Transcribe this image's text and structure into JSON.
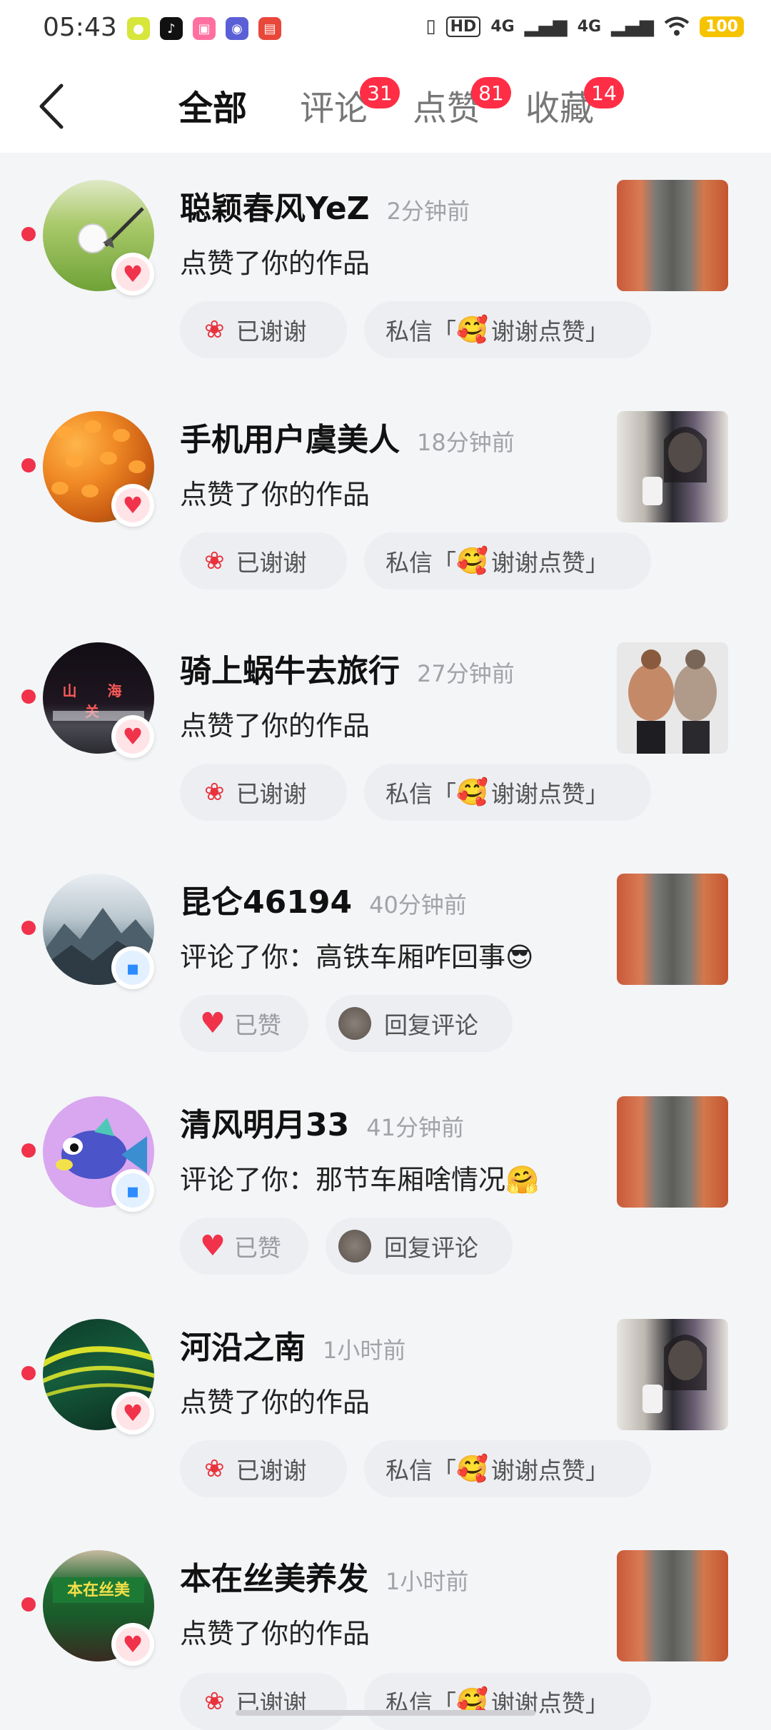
{
  "status_bar": {
    "time": "05:43",
    "network_1": "4G",
    "network_2": "4G",
    "hd_label": "HD",
    "battery": "100"
  },
  "header": {
    "tabs": [
      {
        "label": "全部",
        "active": true
      },
      {
        "label": "评论",
        "badge": "31"
      },
      {
        "label": "点赞",
        "badge": "81"
      },
      {
        "label": "收藏",
        "badge": "14"
      }
    ]
  },
  "notifications": [
    {
      "name": "聪颖春风YeZ",
      "time": "2分钟前",
      "action": "点赞了你的作品",
      "type": "like",
      "buttons": {
        "thanked": "已谢谢",
        "dm_prefix": "私信「",
        "dm_text": "谢谢点赞",
        "dm_suffix": "」"
      }
    },
    {
      "name": "手机用户虞美人",
      "time": "18分钟前",
      "action": "点赞了你的作品",
      "type": "like",
      "buttons": {
        "thanked": "已谢谢",
        "dm_prefix": "私信「",
        "dm_text": "谢谢点赞",
        "dm_suffix": "」"
      }
    },
    {
      "name": "骑上蜗牛去旅行",
      "time": "27分钟前",
      "action": "点赞了你的作品",
      "type": "like",
      "buttons": {
        "thanked": "已谢谢",
        "dm_prefix": "私信「",
        "dm_text": "谢谢点赞",
        "dm_suffix": "」"
      }
    },
    {
      "name": "昆仑46194",
      "time": "40分钟前",
      "action": "评论了你：高铁车厢咋回事😎",
      "type": "comment",
      "buttons": {
        "liked": "已赞",
        "reply": "回复评论"
      }
    },
    {
      "name": "清风明月33",
      "time": "41分钟前",
      "action": "评论了你：那节车厢啥情况🤗",
      "type": "comment",
      "buttons": {
        "liked": "已赞",
        "reply": "回复评论"
      }
    },
    {
      "name": "河沿之南",
      "time": "1小时前",
      "action": "点赞了你的作品",
      "type": "like",
      "buttons": {
        "thanked": "已谢谢",
        "dm_prefix": "私信「",
        "dm_text": "谢谢点赞",
        "dm_suffix": "」"
      }
    },
    {
      "name": "本在丝美养发",
      "time": "1小时前",
      "action": "点赞了你的作品",
      "type": "like",
      "buttons": {
        "thanked": "已谢谢",
        "dm_prefix": "私信「",
        "dm_text": "谢谢点赞",
        "dm_suffix": "」"
      }
    }
  ],
  "avatar_signs": {
    "item3": "山 海 关",
    "item7": "本在丝美"
  },
  "colors": {
    "accent_red": "#ff2d45",
    "unread_dot": "#f0324a",
    "pill_bg": "#eceef2"
  }
}
